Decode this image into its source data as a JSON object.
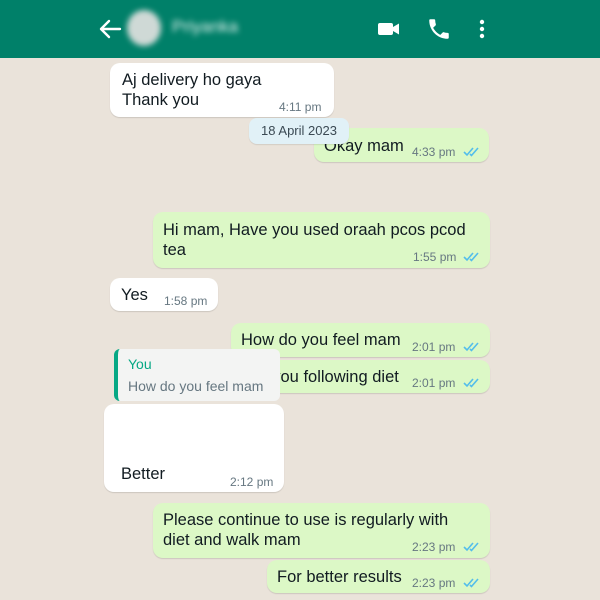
{
  "header": {
    "contact_name": "Priyanka",
    "accent_color": "#008069",
    "icons": [
      "back-arrow-icon",
      "video-call-icon",
      "voice-call-icon",
      "more-options-icon"
    ]
  },
  "messages": [
    {
      "direction": "incoming",
      "lines": [
        "Aj delivery ho gaya",
        "Thank you"
      ],
      "time": "4:11 pm"
    },
    {
      "direction": "outgoing",
      "text": "Okay mam",
      "time": "4:33 pm",
      "status": "read"
    },
    {
      "type": "date",
      "text": "18 April 2023"
    },
    {
      "direction": "outgoing",
      "lines": [
        "Hi mam, Have you used oraah pcos pcod",
        "tea"
      ],
      "time": "1:55 pm",
      "status": "read"
    },
    {
      "direction": "incoming",
      "text": "Yes",
      "time": "1:58 pm"
    },
    {
      "direction": "outgoing",
      "text": "How do you feel mam",
      "time": "2:01 pm",
      "status": "read"
    },
    {
      "direction": "outgoing",
      "text": "Are you following diet",
      "time": "2:01 pm",
      "status": "read"
    },
    {
      "direction": "incoming",
      "reply_to": {
        "author": "You",
        "text": "How do you feel mam"
      },
      "text": "Better",
      "time": "2:12 pm"
    },
    {
      "direction": "outgoing",
      "lines": [
        "Please continue to use is regularly with",
        "diet and walk mam"
      ],
      "time": "2:23 pm",
      "status": "read"
    },
    {
      "direction": "outgoing",
      "text": "For better results",
      "time": "2:23 pm",
      "status": "read"
    }
  ]
}
